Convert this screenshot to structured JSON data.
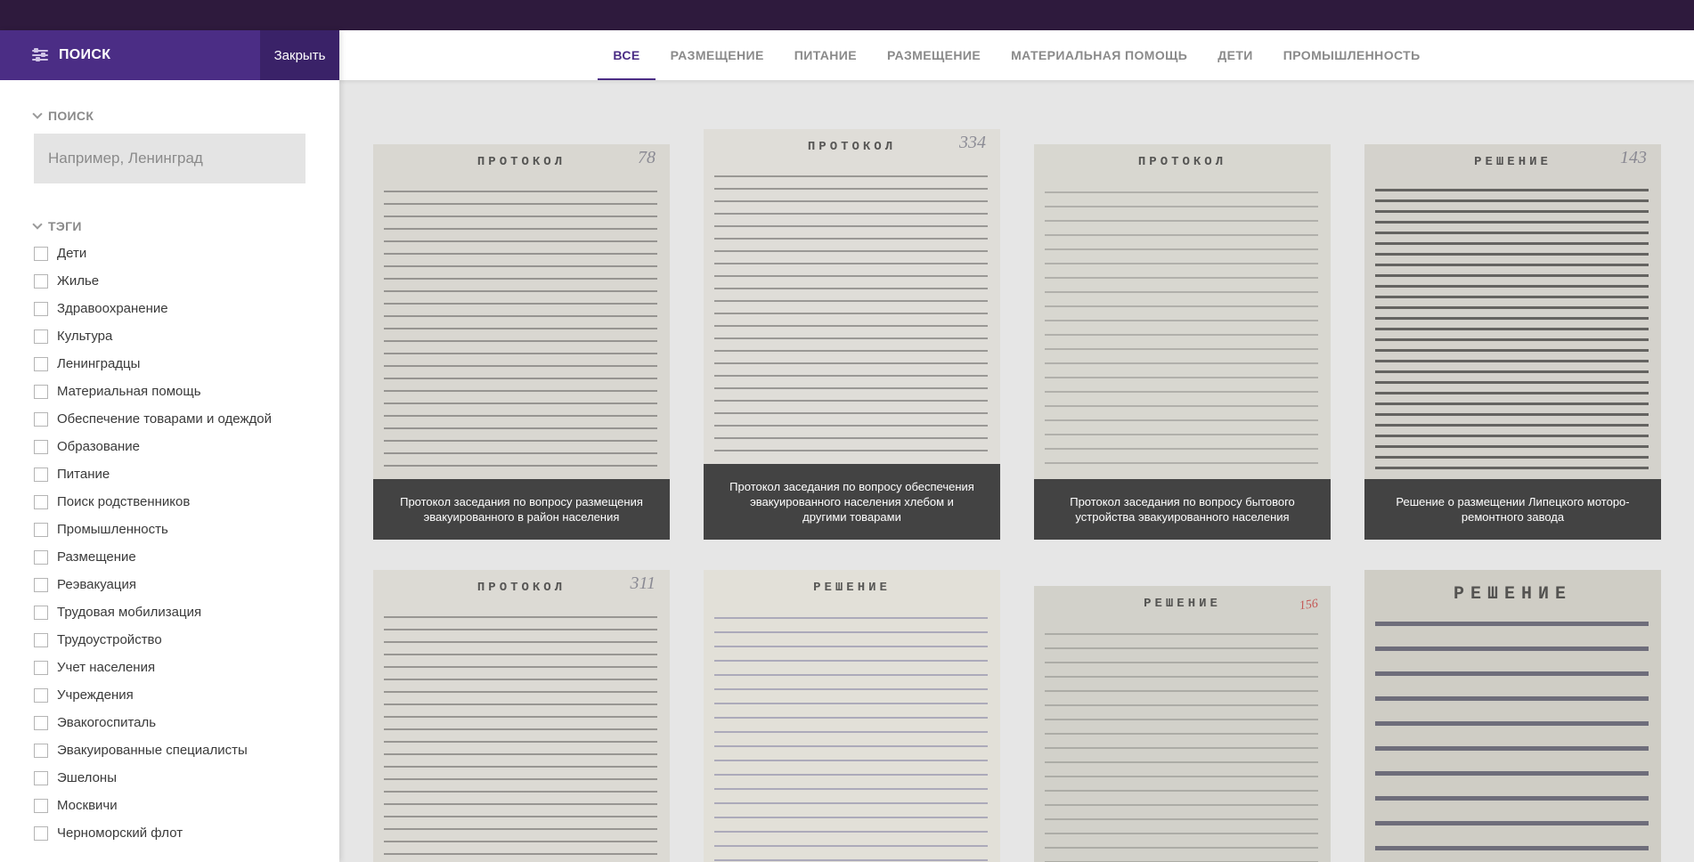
{
  "sidebar": {
    "title": "ПОИСК",
    "close_label": "Закрыть",
    "search": {
      "heading": "ПОИСК",
      "placeholder": "Например, Ленинград"
    },
    "tags": {
      "heading": "ТЭГИ",
      "items": [
        "Дети",
        "Жилье",
        "Здравоохранение",
        "Культура",
        "Ленинградцы",
        "Материальная помощь",
        "Обеспечение товарами и одеждой",
        "Образование",
        "Питание",
        "Поиск родственников",
        "Промышленность",
        "Размещение",
        "Реэвакуация",
        "Трудовая мобилизация",
        "Трудоустройство",
        "Учет населения",
        "Учреждения",
        "Эвакогоспиталь",
        "Эвакуированные специалисты",
        "Эшелоны",
        "Москвичи",
        "Черноморский флот"
      ]
    }
  },
  "tabs": [
    {
      "label": "ВСЕ",
      "active": true
    },
    {
      "label": "РАЗМЕЩЕНИЕ",
      "active": false
    },
    {
      "label": "ПИТАНИЕ",
      "active": false
    },
    {
      "label": "РАЗМЕЩЕНИЕ",
      "active": false
    },
    {
      "label": "МАТЕРИАЛЬНАЯ ПОМОЩЬ",
      "active": false
    },
    {
      "label": "ДЕТИ",
      "active": false
    },
    {
      "label": "ПРОМЫШЛЕННОСТЬ",
      "active": false
    }
  ],
  "cards": [
    {
      "header": "ПРОТОКОЛ",
      "number": "78",
      "caption": "Протокол заседания по вопросу размещения эвакуированного в район населения"
    },
    {
      "header": "ПРОТОКОЛ",
      "number": "334",
      "caption": "Протокол заседания по вопросу обеспечения эвакуированного населения хлебом и другими товарами"
    },
    {
      "header": "ПРОТОКОЛ",
      "number": "",
      "caption": "Протокол заседания по вопросу бытового устройства эвакуированного населения"
    },
    {
      "header": "РЕШЕНИЕ",
      "number": "143",
      "caption": "Решение о размещении Липецкого моторо-ремонтного завода"
    },
    {
      "header": "ПРОТОКОЛ",
      "number": "311",
      "caption": ""
    },
    {
      "header": "РЕШЕНИЕ",
      "number": "",
      "caption": ""
    },
    {
      "header": "РЕШЕНИЕ",
      "number": "156",
      "caption": ""
    },
    {
      "header": "РЕШЕНИЕ",
      "number": "",
      "caption": ""
    }
  ],
  "colors": {
    "topbar": "#2e1a3d",
    "accent": "#4b2d85",
    "close_bg": "#3a2268",
    "caption_bg": "#434343",
    "content_bg": "#e6e6e6"
  }
}
